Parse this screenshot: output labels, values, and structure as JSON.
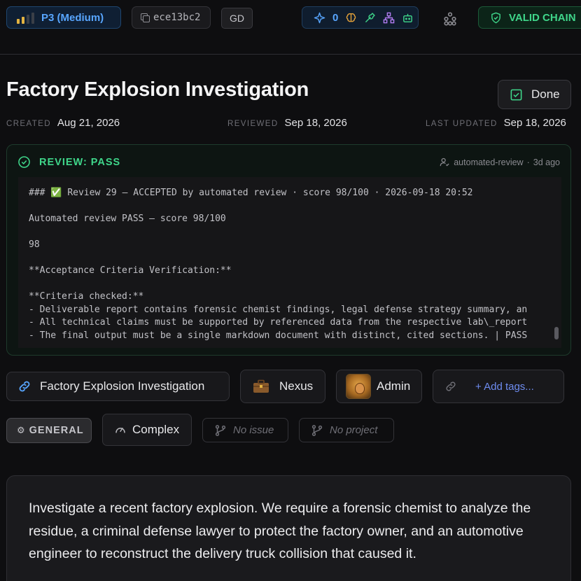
{
  "topbar": {
    "priority": {
      "label": "P3 (Medium)",
      "level": 2,
      "max_level": 4,
      "color": "#58a6ff"
    },
    "hash": "ece13bc2",
    "initials": "GD",
    "agents_count": "0",
    "status": {
      "label": "VALID CHAIN",
      "color": "#3fd68a"
    }
  },
  "title": "Factory Explosion Investigation",
  "done_button": {
    "label": "Done"
  },
  "dates": {
    "created_label": "CREATED",
    "created": "Aug 21, 2026",
    "reviewed_label": "REVIEWED",
    "reviewed": "Sep 18, 2026",
    "updated_label": "LAST UPDATED",
    "updated": "Sep 18, 2026"
  },
  "review": {
    "status": "REVIEW: PASS",
    "reviewer": "automated-review",
    "separator": "·",
    "when": "3d ago",
    "body": "### ✅ Review 29 — ACCEPTED by automated review · score 98/100 · 2026-09-18 20:52\n\nAutomated review PASS — score 98/100\n\n98\n\n**Acceptance Criteria Verification:**\n\n**Criteria checked:**\n- Deliverable report contains forensic chemist findings, legal defense strategy summary, an\n- All technical claims must be supported by referenced data from the respective lab\\_report\n- The final output must be a single markdown document with distinct, cited sections. | PASS"
  },
  "tags": {
    "link": "Factory Explosion Investigation",
    "team": "Nexus",
    "owner": "Admin",
    "add_tags": "+ Add tags..."
  },
  "meta_row": {
    "category": "GENERAL",
    "complexity": "Complex",
    "issue": "No issue",
    "project": "No project"
  },
  "description": "Investigate a recent factory explosion. We require a forensic chemist to analyze the residue, a criminal defense lawyer to protect the factory owner, and an automotive engineer to reconstruct the delivery truck collision that caused it."
}
